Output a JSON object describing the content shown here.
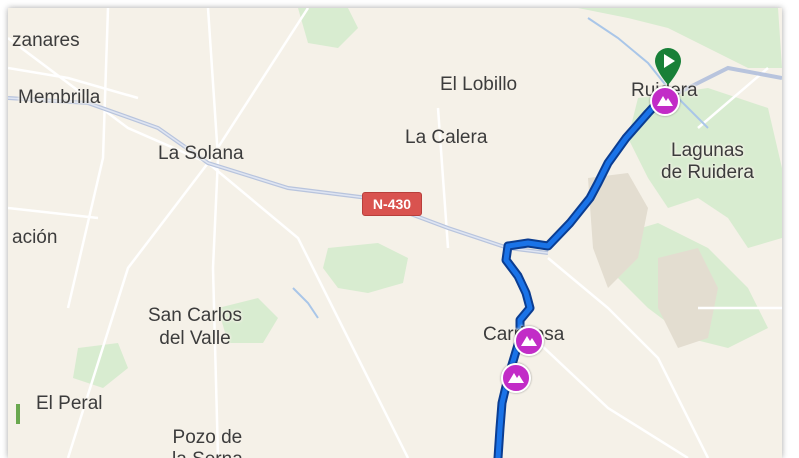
{
  "map": {
    "colors": {
      "land": "#f5f1e8",
      "park": "#d8ecd0",
      "route": "#1a73e8",
      "route_outline": "#0b3d91",
      "road": "#b8c4dd",
      "waypoint": "#c22cc7",
      "start_pin": "#188038",
      "road_shield": "#d9534f"
    },
    "places": [
      {
        "id": "manzanares",
        "text": "zanares"
      },
      {
        "id": "membrilla",
        "text": "Membrilla"
      },
      {
        "id": "la-solana",
        "text": "La Solana"
      },
      {
        "id": "el-lobillo",
        "text": "El Lobillo"
      },
      {
        "id": "la-calera",
        "text": "La Calera"
      },
      {
        "id": "ruidera",
        "text": "Ruidera"
      },
      {
        "id": "lagunas",
        "text": "Lagunas\nde Ruidera"
      },
      {
        "id": "estacion",
        "text": "ación"
      },
      {
        "id": "san-carlos",
        "text": "San Carlos\ndel Valle"
      },
      {
        "id": "carrizosa",
        "text": "Carrizosa"
      },
      {
        "id": "el-peral",
        "text": "El Peral"
      },
      {
        "id": "pozo-serna",
        "text": "Pozo de\nla Serna"
      }
    ],
    "road_shield": "N-430",
    "icons": {
      "start": "play-triangle-icon",
      "waypoint": "mountain-peak-icon"
    }
  }
}
